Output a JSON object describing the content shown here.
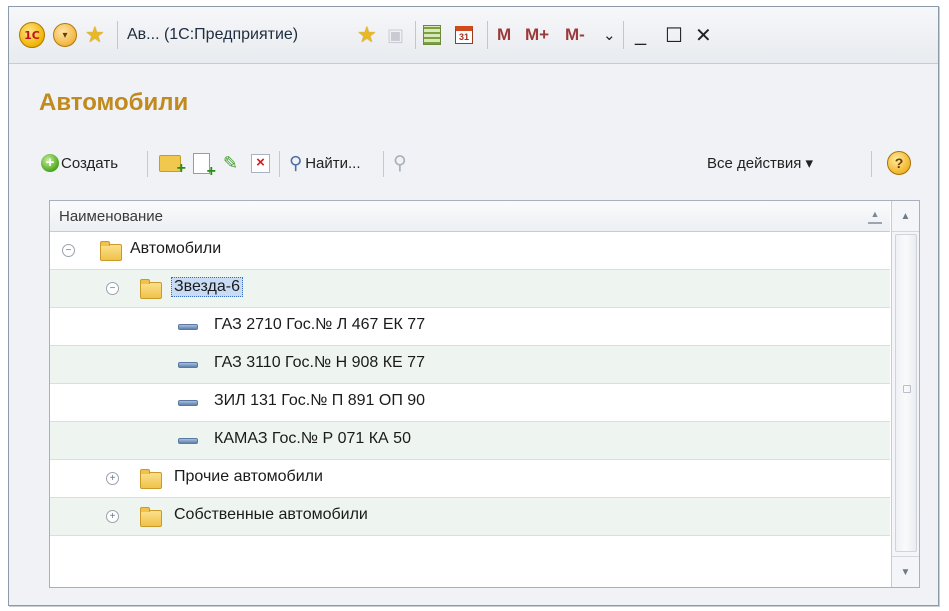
{
  "titlebar": {
    "title": "Ав... (1С:Предприятие)",
    "logo_text": "1С",
    "icons": [
      "1c-logo-icon",
      "menu-arrow-icon",
      "favorites-star-icon",
      "add-favorite-icon",
      "history-icon",
      "calculator-icon",
      "calendar-icon"
    ],
    "calendar_day": "31",
    "m_label": "M",
    "m_plus_label": "M+",
    "m_minus_label": "M-",
    "dropdown_glyph": "⌄",
    "minimize_glyph": "_",
    "maximize_glyph": "☐",
    "close_glyph": "✕"
  },
  "form": {
    "title": "Автомобили"
  },
  "toolbar": {
    "create_label": "Создать",
    "find_label": "Найти...",
    "all_actions_label": "Все действия ▾",
    "help_label": "?"
  },
  "table": {
    "column_header": "Наименование",
    "rows": [
      {
        "level": 0,
        "type": "group",
        "expanded": true,
        "label": "Автомобили"
      },
      {
        "level": 1,
        "type": "group",
        "expanded": true,
        "label": "Звезда-6",
        "selected": true
      },
      {
        "level": 2,
        "type": "item",
        "label": "ГАЗ 2710 Гос.№ Л 467 ЕК 77"
      },
      {
        "level": 2,
        "type": "item",
        "label": "ГАЗ 3110 Гос.№ Н 908 КЕ 77"
      },
      {
        "level": 2,
        "type": "item",
        "label": "ЗИЛ 131 Гос.№ П 891 ОП 90"
      },
      {
        "level": 2,
        "type": "item",
        "label": "КАМАЗ Гос.№ Р 071 КА 50"
      },
      {
        "level": 1,
        "type": "group",
        "expanded": false,
        "label": "Прочие автомобили"
      },
      {
        "level": 1,
        "type": "group",
        "expanded": false,
        "label": "Собственные автомобили"
      }
    ]
  },
  "colors": {
    "title_accent": "#c08a1e",
    "selection": "#c9dcf6",
    "alt_row": "#eef5f0"
  }
}
